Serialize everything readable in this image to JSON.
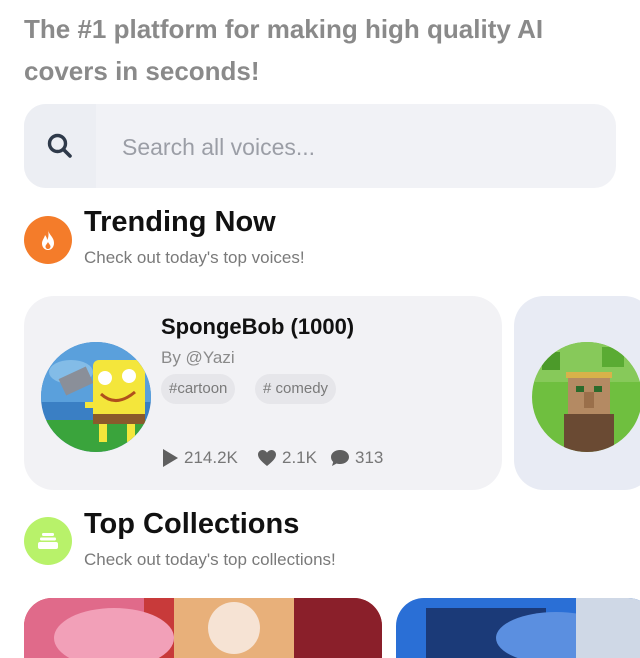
{
  "tagline": "The #1 platform for making high quality AI covers in seconds!",
  "search": {
    "placeholder": "Search all voices..."
  },
  "trending": {
    "title": "Trending Now",
    "subtitle": "Check out today's top voices!",
    "cards": [
      {
        "name": "SpongeBob (1000)",
        "by": "By @Yazi",
        "tags": [
          "#cartoon",
          "# comedy"
        ],
        "plays": "214.2K",
        "likes": "2.1K",
        "comments": "313"
      }
    ]
  },
  "collections": {
    "title": "Top Collections",
    "subtitle": "Check out today's top collections!"
  },
  "colors": {
    "trending_icon_bg": "#f47c2a",
    "collections_icon_bg": "#b8f26a"
  }
}
